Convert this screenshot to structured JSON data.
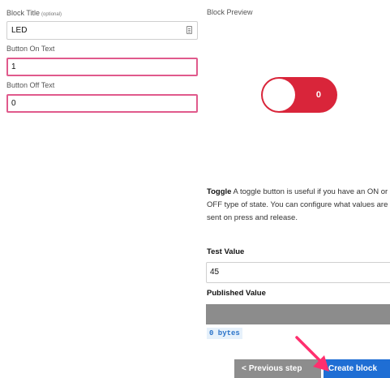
{
  "form": {
    "block_title_label": "Block Title",
    "block_title_optional": "(optional)",
    "block_title_value": "LED",
    "on_text_label": "Button On Text",
    "on_text_value": "1",
    "off_text_label": "Button Off Text",
    "off_text_value": "0"
  },
  "preview": {
    "title": "Block Preview",
    "toggle_state_text": "0"
  },
  "description": {
    "heading": "Toggle",
    "text": " A toggle button is useful if you have an ON or OFF type of state. You can configure what values are sent on press and release."
  },
  "test": {
    "label": "Test Value",
    "value": "45"
  },
  "published": {
    "label": "Published Value",
    "bytes": "0 bytes"
  },
  "buttons": {
    "previous_chevron": "<",
    "previous": "Previous step",
    "create": "Create block"
  },
  "colors": {
    "toggle_background": "#d9253a",
    "error_border": "#e05a8c",
    "primary_button": "#1f6ed4",
    "secondary_button": "#8d8d8d",
    "annotation_arrow": "#ff2f6e"
  },
  "icons": {
    "title_field_icon": "clipboard-icon",
    "annotation": "arrow-icon"
  }
}
